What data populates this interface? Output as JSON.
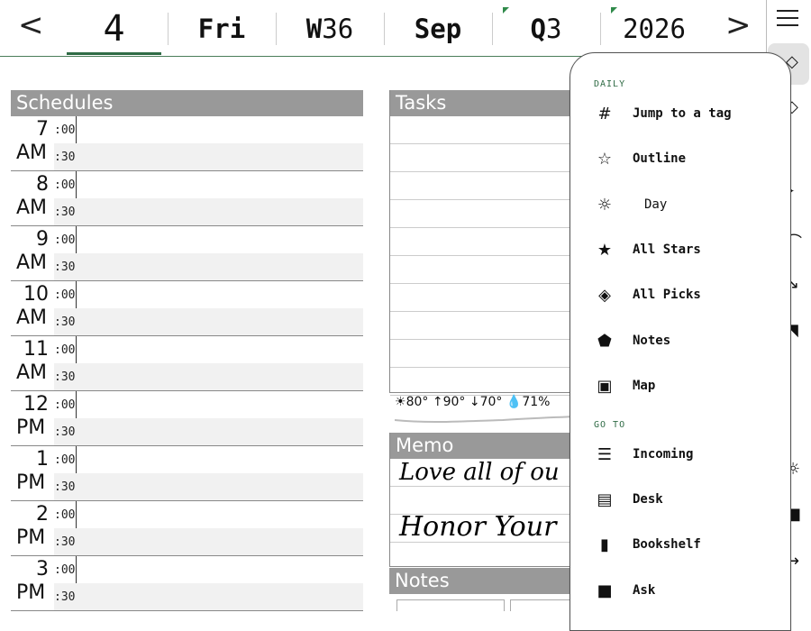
{
  "topbar": {
    "prev": "<",
    "next": ">",
    "day": "4",
    "weekday": "Fri",
    "week_b": "W",
    "week_n": "36",
    "month_b": "S",
    "month_rest": "ep",
    "quarter_b": "Q",
    "quarter_n": "3",
    "year": "2026",
    "accent_color": "#2f6b45"
  },
  "schedules": {
    "title": "Schedules",
    "min_top": ":00",
    "min_bottom": ":30",
    "hours": [
      {
        "n": "7",
        "p": "AM"
      },
      {
        "n": "8",
        "p": "AM"
      },
      {
        "n": "9",
        "p": "AM"
      },
      {
        "n": "10",
        "p": "AM"
      },
      {
        "n": "11",
        "p": "AM"
      },
      {
        "n": "12",
        "p": "PM"
      },
      {
        "n": "1",
        "p": "PM"
      },
      {
        "n": "2",
        "p": "PM"
      },
      {
        "n": "3",
        "p": "PM"
      }
    ]
  },
  "tasks": {
    "title": "Tasks"
  },
  "weather": {
    "current": "80°",
    "high": "90°",
    "low": "70°",
    "humidity": "71%"
  },
  "memo": {
    "title": "Memo",
    "line1": "Love all of ou",
    "line2": "Honor Your "
  },
  "notes": {
    "title": "Notes"
  },
  "menu": {
    "daily_header": "DAILY",
    "goto_header": "GO TO",
    "items": [
      {
        "icon": "#",
        "icon_name": "hash-icon",
        "label": "Jump to a tag"
      },
      {
        "icon": "☆",
        "icon_name": "star-outline-icon",
        "label": "Outline"
      },
      {
        "icon": "☼",
        "icon_name": "sun-icon",
        "label": "Day"
      },
      {
        "icon": "★",
        "icon_name": "star-filled-icon",
        "label": "All Stars"
      },
      {
        "icon": "◈",
        "icon_name": "diamond-icon",
        "label": "All Picks"
      },
      {
        "icon": "⬟",
        "icon_name": "pen-nib-icon",
        "label": "Notes"
      },
      {
        "icon": "▣",
        "icon_name": "map-icon",
        "label": "Map"
      },
      {
        "icon": "☰",
        "icon_name": "rss-icon",
        "label": "Incoming"
      },
      {
        "icon": "▤",
        "icon_name": "document-icon",
        "label": "Desk"
      },
      {
        "icon": "▮",
        "icon_name": "book-icon",
        "label": "Bookshelf"
      },
      {
        "icon": "■",
        "icon_name": "chat-icon",
        "label": "Ask"
      }
    ]
  },
  "sidebar": {
    "close": "✕"
  }
}
